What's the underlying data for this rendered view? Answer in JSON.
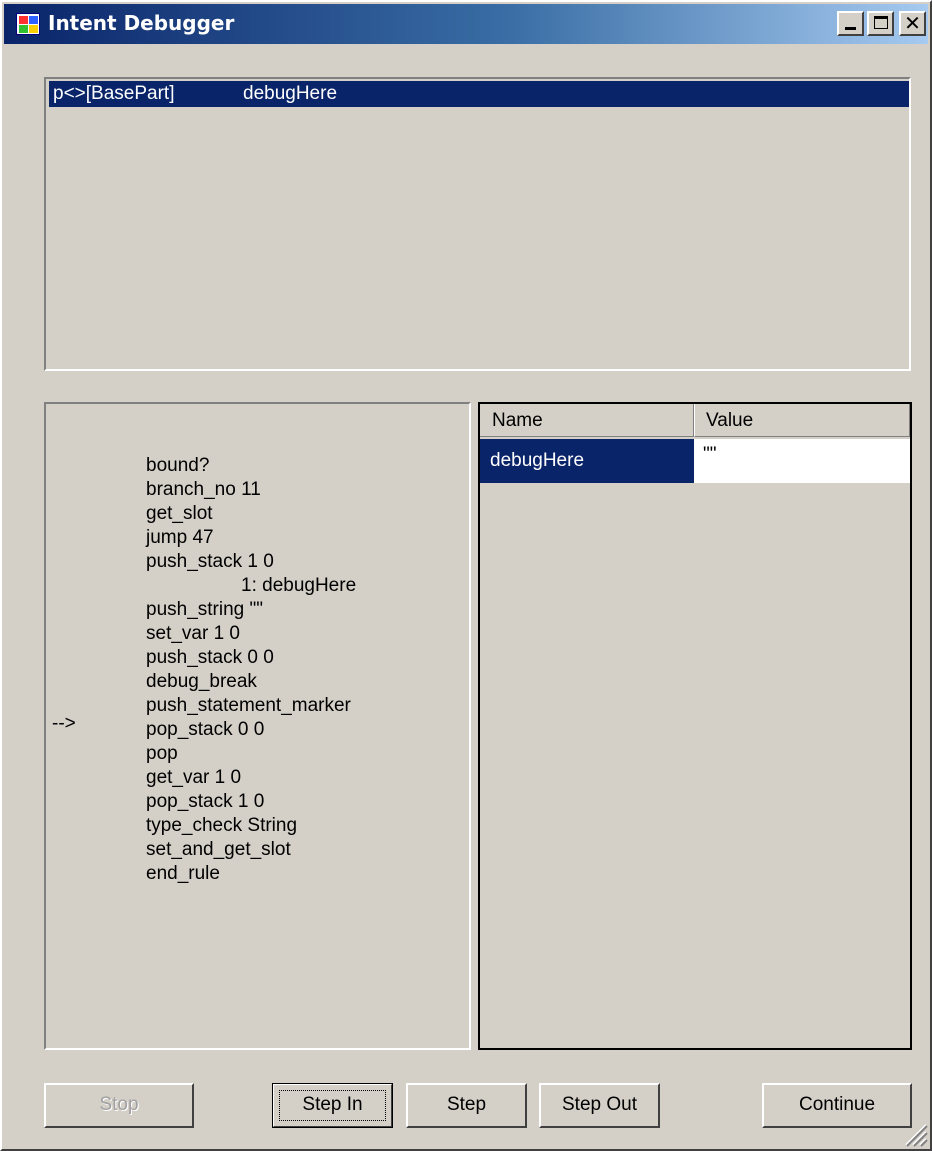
{
  "window": {
    "title": "Intent Debugger"
  },
  "call_stack": {
    "rows": [
      {
        "frame": "p<>[BasePart]",
        "method": "debugHere"
      }
    ]
  },
  "code": {
    "current_marker": "-->",
    "lines": [
      "bound?",
      "branch_no 11",
      "get_slot",
      "jump 47",
      "push_stack 1 0",
      "1: debugHere",
      "push_string \"\"",
      "set_var 1 0",
      "push_stack 0 0",
      "debug_break",
      "push_statement_marker",
      "pop_stack 0 0",
      "pop",
      "get_var 1 0",
      "pop_stack 1 0",
      "type_check String",
      "set_and_get_slot",
      "end_rule"
    ]
  },
  "variables": {
    "columns": {
      "name": "Name",
      "value": "Value"
    },
    "rows": [
      {
        "name": "debugHere",
        "value": "\"\""
      }
    ]
  },
  "buttons": {
    "stop": "Stop",
    "step_in": "Step In",
    "step": "Step",
    "step_out": "Step Out",
    "continue": "Continue"
  }
}
